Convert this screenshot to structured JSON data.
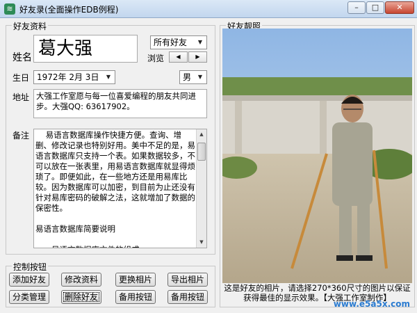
{
  "window": {
    "title": "好友录(全面操作EDB例程)"
  },
  "friend_info": {
    "legend": "好友资料",
    "name_label": "姓名",
    "name_value": "葛大强",
    "filter_value": "所有好友",
    "browse_label": "浏览",
    "birthday_label": "生日",
    "birthday_value": "1972年 2月 3日",
    "gender_value": "男",
    "address_label": "地址",
    "address_value": "大强工作室愿与每一位喜爱编程的朋友共同进步。大强QQ: 63617902。",
    "notes_label": "备注",
    "notes_value": "    易语言数据库操作快捷方便。查询、增删、修改记录也特别好用。美中不足的是，易语言数据库只支持一个表。如果数据较多，不可以放在一张表里，用易语言数据库就显得烦琐了。即便如此，在一些地方还是用易库比较。因为数据库可以加密，到目前为止还没有针对易库密码的破解之法，这就增加了数据的保密性。\n\n易语言数据库简要说明\n\n一、易语言数据库文件的组成\n\n    .edb  数据库主文件"
  },
  "controls": {
    "legend": "控制按钮",
    "buttons": {
      "add": "添加好友",
      "edit": "修改资料",
      "change_photo": "更换相片",
      "export_photo": "导出相片",
      "category": "分类管理",
      "delete": "删除好友",
      "spare1": "备用按钮",
      "spare2": "备用按钮"
    }
  },
  "photo_panel": {
    "legend": "好友靓照",
    "caption": "这是好友的相片，请选择270*360尺寸的图片以保证获得最佳的显示效果。【大强工作室制作】"
  },
  "watermark": "www.e5a5x.com",
  "icons": {
    "app": "app-icon",
    "minimize": "minimize-icon",
    "maximize": "maximize-icon",
    "close": "close-icon",
    "dropdown": "chevron-down-icon",
    "spin_left": "chevron-left-icon",
    "spin_right": "chevron-right-icon"
  }
}
